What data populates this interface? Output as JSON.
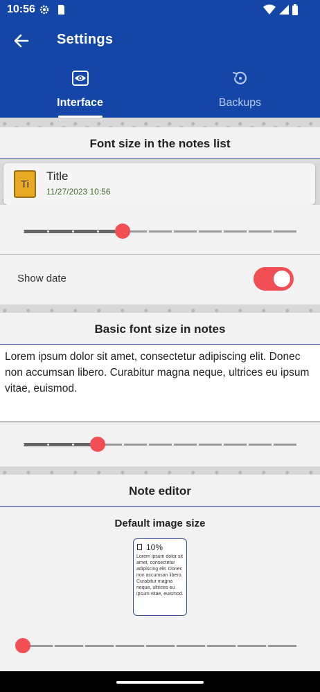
{
  "status_bar": {
    "time": "10:56",
    "icons": [
      "gear-icon",
      "sd-card-icon",
      "wifi-icon",
      "notification-icon",
      "battery-icon"
    ]
  },
  "app_bar": {
    "title": "Settings",
    "back_icon": "arrow-left-icon"
  },
  "tabs": [
    {
      "label": "Interface",
      "icon": "eye-icon",
      "selected": true
    },
    {
      "label": "Backups",
      "icon": "restore-icon",
      "selected": false
    }
  ],
  "font_size_list": {
    "header": "Font size in the notes list",
    "note": {
      "icon_text": "Ti",
      "title": "Title",
      "date": "11/27/2023 10:56"
    },
    "slider": {
      "steps": 12,
      "value_index": 4
    }
  },
  "show_date": {
    "label": "Show date",
    "enabled": true
  },
  "basic_font_size": {
    "header": "Basic font size in notes",
    "sample_text": "Lorem ipsum dolor sit amet, consectetur adipiscing elit. Donec non accumsan libero. Curabitur magna neque, ultrices eu ipsum vitae, euismod.",
    "slider": {
      "steps": 12,
      "value_index": 3
    }
  },
  "note_editor": {
    "header": "Note editor",
    "default_image_size": {
      "label": "Default image size",
      "percent": "10%",
      "preview_text": "Lorem ipsum dolor sit amet, consectetur adipiscing elit. Donec non accumsan libero. Curabitur magna neque, ultrices eu ipsum vitae, euismod.",
      "slider": {
        "steps": 10,
        "value_index": 0
      }
    }
  },
  "colors": {
    "primary": "#1446a8",
    "accent": "#f24f55",
    "date_green": "#3d6b2a",
    "note_icon": "#e8a924"
  }
}
